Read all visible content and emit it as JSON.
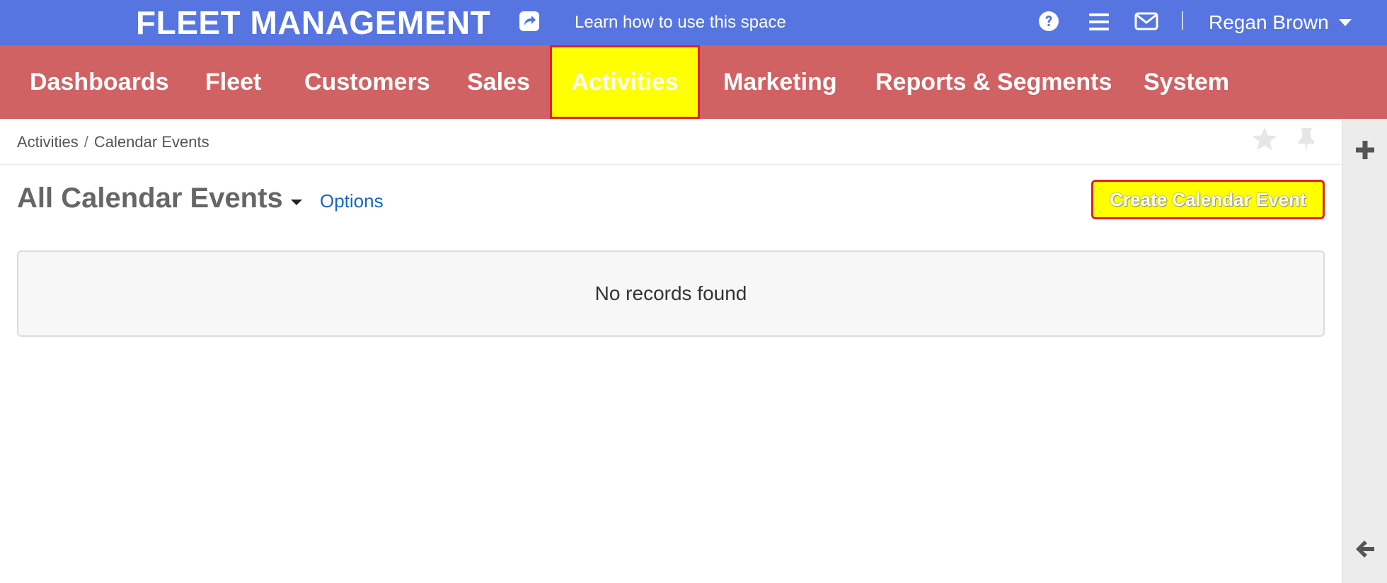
{
  "topbar": {
    "brand": "FLEET MANAGEMENT",
    "learn_link": "Learn how to use this space",
    "user_name": "Regan Brown",
    "icons": [
      "share-icon",
      "help-circle-icon",
      "hamburger-menu-icon",
      "envelope-icon",
      "caret-down-icon"
    ],
    "color": "#5675e0"
  },
  "nav": {
    "color": "#d06263",
    "active_color": "#ffff00",
    "items": [
      {
        "label": "Dashboards"
      },
      {
        "label": "Fleet"
      },
      {
        "label": "Customers"
      },
      {
        "label": "Sales"
      },
      {
        "label": "Activities",
        "active": true
      },
      {
        "label": "Marketing"
      },
      {
        "label": "Reports & Segments"
      },
      {
        "label": "System"
      }
    ]
  },
  "breadcrumb": {
    "items": [
      "Activities",
      "Calendar Events"
    ],
    "separator": "/"
  },
  "page": {
    "title": "All Calendar Events",
    "options_label": "Options",
    "create_button": "Create Calendar Event",
    "empty_message": "No records found"
  },
  "rightrail": {
    "icons": [
      "plus-icon",
      "arrow-left-icon"
    ]
  }
}
